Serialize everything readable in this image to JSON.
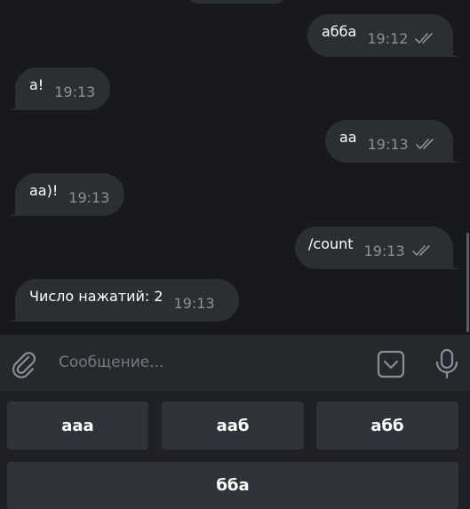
{
  "messages": [
    {
      "side": "out",
      "text": "абба",
      "time": "19:12",
      "read": true
    },
    {
      "side": "in",
      "text": "а!",
      "time": "19:13"
    },
    {
      "side": "out",
      "text": "аа",
      "time": "19:13",
      "read": true
    },
    {
      "side": "in",
      "text": "аа)!",
      "time": "19:13"
    },
    {
      "side": "out",
      "text": "/count",
      "time": "19:13",
      "read": true
    },
    {
      "side": "in",
      "text": "Число нажатий: 2",
      "time": "19:13"
    }
  ],
  "composer": {
    "placeholder": "Сообщение...",
    "attach_icon": "paperclip-icon",
    "keyboard_icon": "keyboard-toggle-icon",
    "mic_icon": "microphone-icon"
  },
  "keyboard": {
    "row1": [
      "ааа",
      "ааб",
      "абб"
    ],
    "row2": [
      "бба"
    ]
  },
  "colors": {
    "background": "#17191d",
    "bubble": "#2b2e33",
    "time": "#8d9095",
    "composer": "#25282d",
    "key": "#30333a",
    "icon": "#8a8e94"
  }
}
